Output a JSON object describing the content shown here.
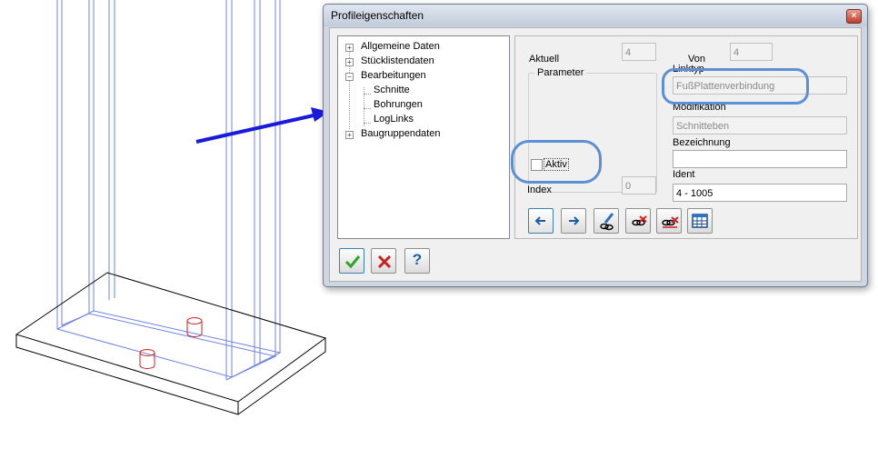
{
  "dialog": {
    "title": "Profileigenschaften",
    "close_symbol": "×"
  },
  "tree": {
    "items": [
      {
        "label": "Allgemeine Daten",
        "expander": "+"
      },
      {
        "label": "Stücklistendaten",
        "expander": "+"
      },
      {
        "label": "Bearbeitungen",
        "expander": "−"
      },
      {
        "label": "Schnitte"
      },
      {
        "label": "Bohrungen"
      },
      {
        "label": "LogLinks"
      },
      {
        "label": "Baugruppendaten",
        "expander": "+"
      }
    ]
  },
  "panel": {
    "aktuell_label": "Aktuell",
    "aktuell_value": "4",
    "von_label": "Von",
    "von_value": "4",
    "parameter_label": "Parameter",
    "linktyp_label": "Linktyp",
    "linktyp_value": "FußPlattenverbindung",
    "modifikation_label": "Modifikation",
    "modifikation_value": "Schnitteben",
    "bezeichnung_label": "Bezeichnung",
    "bezeichnung_value": "",
    "aktiv_label": "Aktiv",
    "aktiv_checked": false,
    "index_label": "Index",
    "index_value": "0",
    "ident_label": "Ident",
    "ident_value": "4 - 1005"
  },
  "toolbar": {
    "icons": [
      "arrow-left-icon",
      "arrow-right-icon",
      "edit-link-icon",
      "delete-link-icon",
      "delete-all-links-icon",
      "table-icon"
    ]
  },
  "bottom": {
    "icons": [
      "checkmark-icon",
      "cancel-icon",
      "help-icon"
    ],
    "help_symbol": "?"
  },
  "colors": {
    "highlight": "#5b8fd6",
    "arrow": "#1a1adc",
    "cad_blue": "#6d82e6",
    "cad_red": "#d02020",
    "accent_blue": "#3c7fb1"
  }
}
